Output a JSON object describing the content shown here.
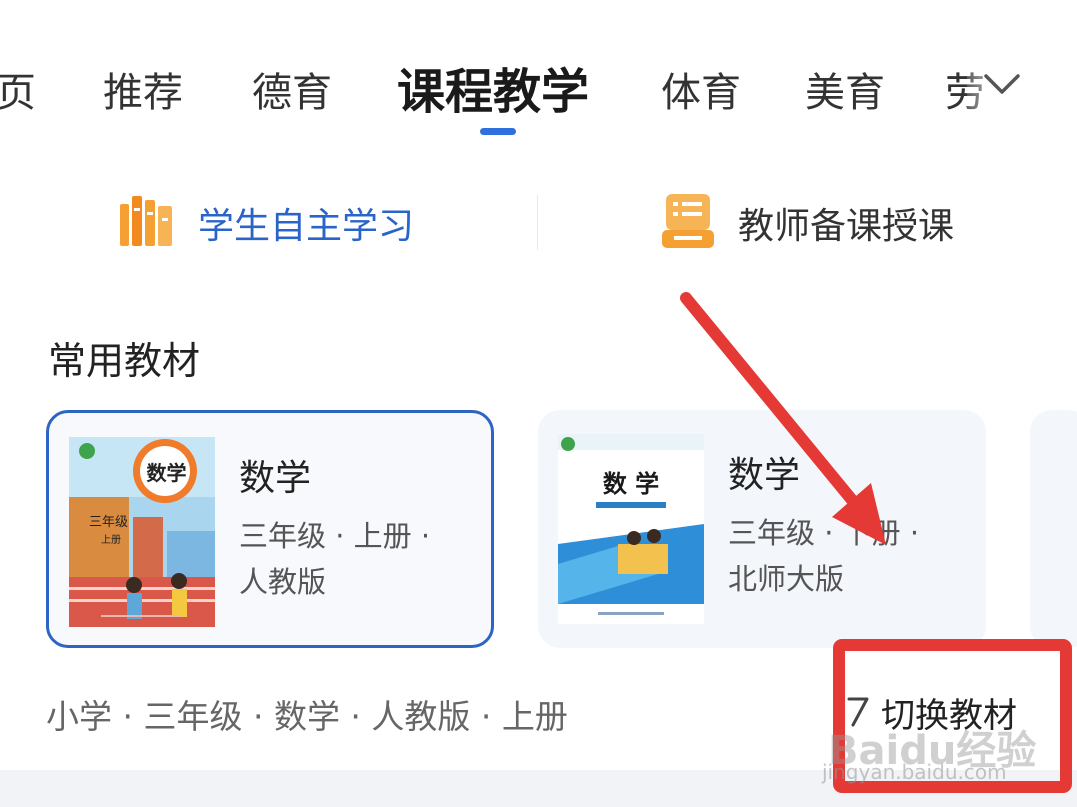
{
  "tabs": {
    "items": [
      {
        "label": "页"
      },
      {
        "label": "推荐"
      },
      {
        "label": "德育"
      },
      {
        "label": "课程教学"
      },
      {
        "label": "体育"
      },
      {
        "label": "美育"
      },
      {
        "label": "劳"
      }
    ],
    "active_index": 3,
    "more_icon": "chevron-down-icon"
  },
  "modes": {
    "student": {
      "label": "学生自主学习",
      "icon": "books-icon",
      "color": "#2a64c8"
    },
    "teacher": {
      "label": "教师备课授课",
      "icon": "lectern-icon",
      "color": "#333333"
    }
  },
  "section": {
    "title": "常用教材"
  },
  "textbooks": [
    {
      "title": "数学",
      "meta_line1": "三年级 · 上册 ·",
      "meta_line2": "人教版",
      "cover_title": "数学",
      "cover_grade": "三年级",
      "cover_volume": "上册",
      "selected": true
    },
    {
      "title": "数学",
      "meta_line1": "三年级 · 下册 ·",
      "meta_line2": "北师大版",
      "cover_title": "数 学",
      "selected": false
    }
  ],
  "footer": {
    "current_info": "小学 · 三年级 · 数学 · 人教版 · 上册",
    "switch_label": "切换教材",
    "switch_icon": "switch-icon"
  },
  "watermark": {
    "brand": "Baidu经验",
    "url": "jingyan.baidu.com"
  },
  "colors": {
    "accent": "#2f6fde",
    "highlight": "#e53935",
    "icon_orange": "#f5a033"
  }
}
